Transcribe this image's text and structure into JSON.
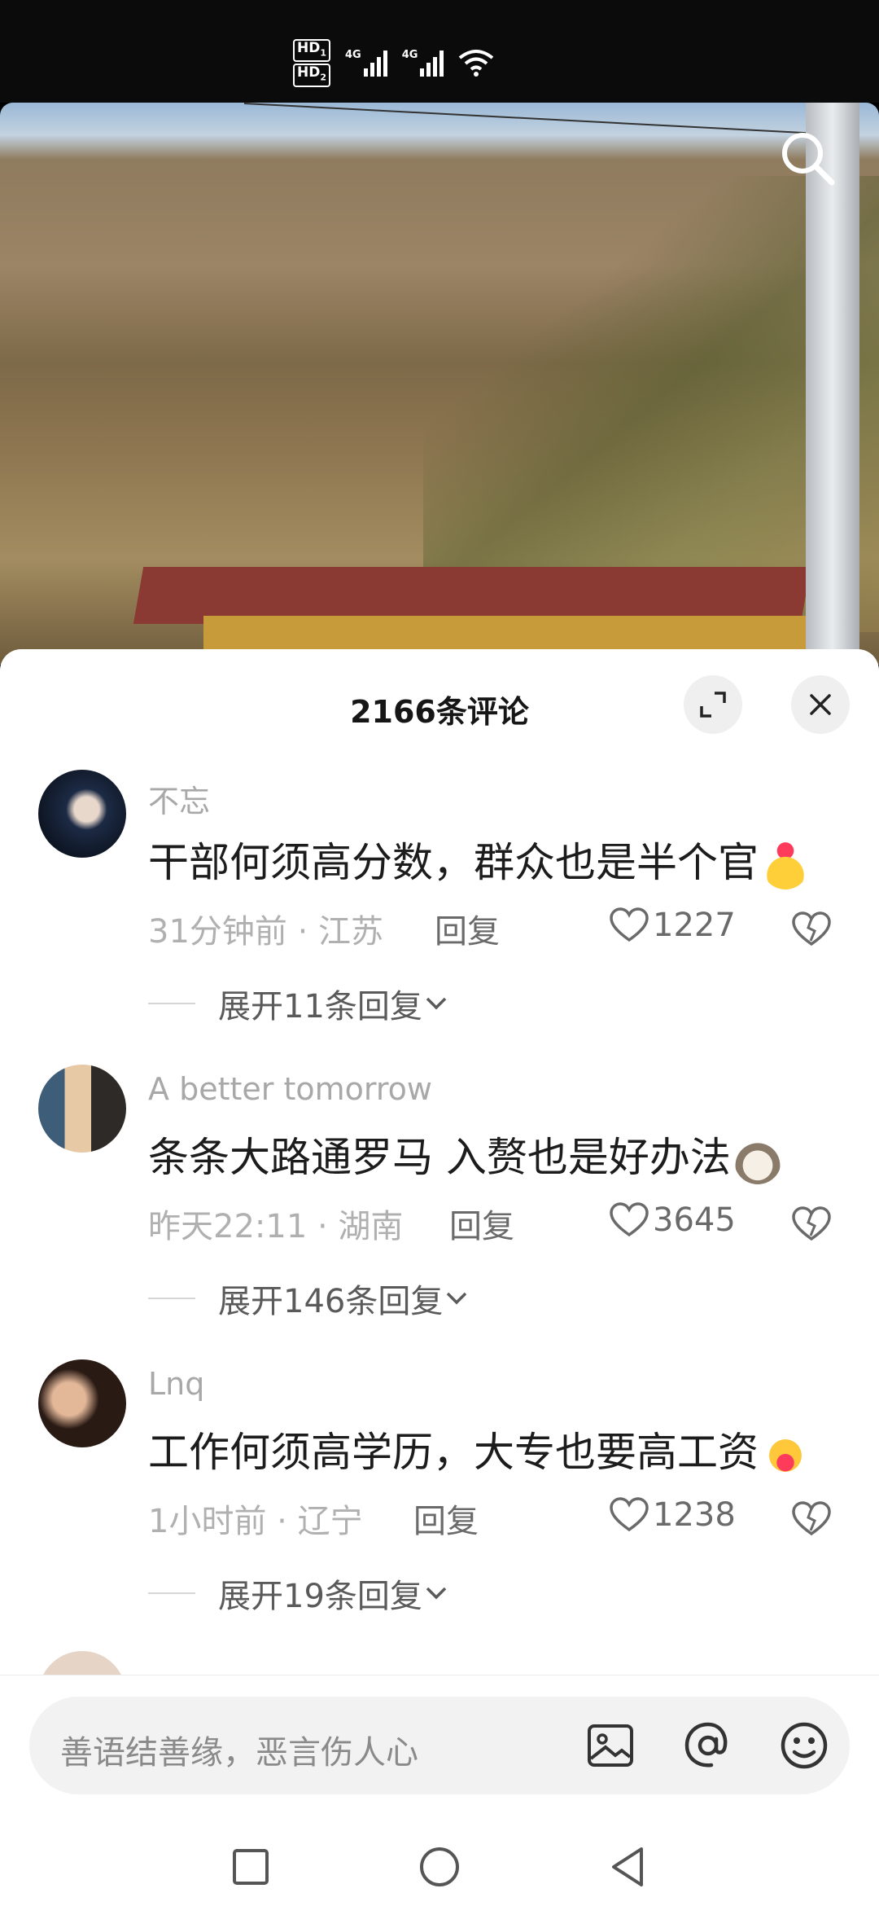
{
  "status_bar": {
    "sim1_label": "HD",
    "sim1_index": "1",
    "sim2_label": "HD",
    "sim2_index": "2",
    "network1": "4G",
    "network2": "4G"
  },
  "video": {
    "search_icon": "search-icon"
  },
  "sheet": {
    "title": "2166条评论",
    "expand_icon": "expand-icon",
    "close_icon": "close-icon"
  },
  "comments": [
    {
      "user": "不忘",
      "text": "干部何须高分数，群众也是半个官",
      "emoji": "finger-heart-emoji",
      "time_location": "31分钟前 · 江苏",
      "reply": "回复",
      "likes": "1227",
      "expand": "展开11条回复"
    },
    {
      "user": "A better tomorrow",
      "text": "条条大路通罗马 入赘也是好办法",
      "emoji": "dog-face-emoji",
      "time_location": "昨天22:11 · 湖南",
      "reply": "回复",
      "likes": "3645",
      "expand": "展开146条回复"
    },
    {
      "user": "Lnq",
      "text": "工作何须高学历，大专也要高工资",
      "emoji": "hugging-heart-emoji",
      "time_location": "1小时前 · 辽宁",
      "reply": "回复",
      "likes": "1238",
      "expand": "展开19条回复"
    }
  ],
  "input": {
    "placeholder": "善语结善缘，恶言伤人心",
    "image_icon": "image-icon",
    "mention_icon": "at-mention-icon",
    "emoji_icon": "emoji-icon"
  },
  "nav": {
    "recent_icon": "square-recent-icon",
    "home_icon": "circle-home-icon",
    "back_icon": "triangle-back-icon"
  },
  "colors": {
    "like_red": "#ff3b5c",
    "text_primary": "#1c1c1c",
    "text_secondary": "#a8a8a8"
  }
}
